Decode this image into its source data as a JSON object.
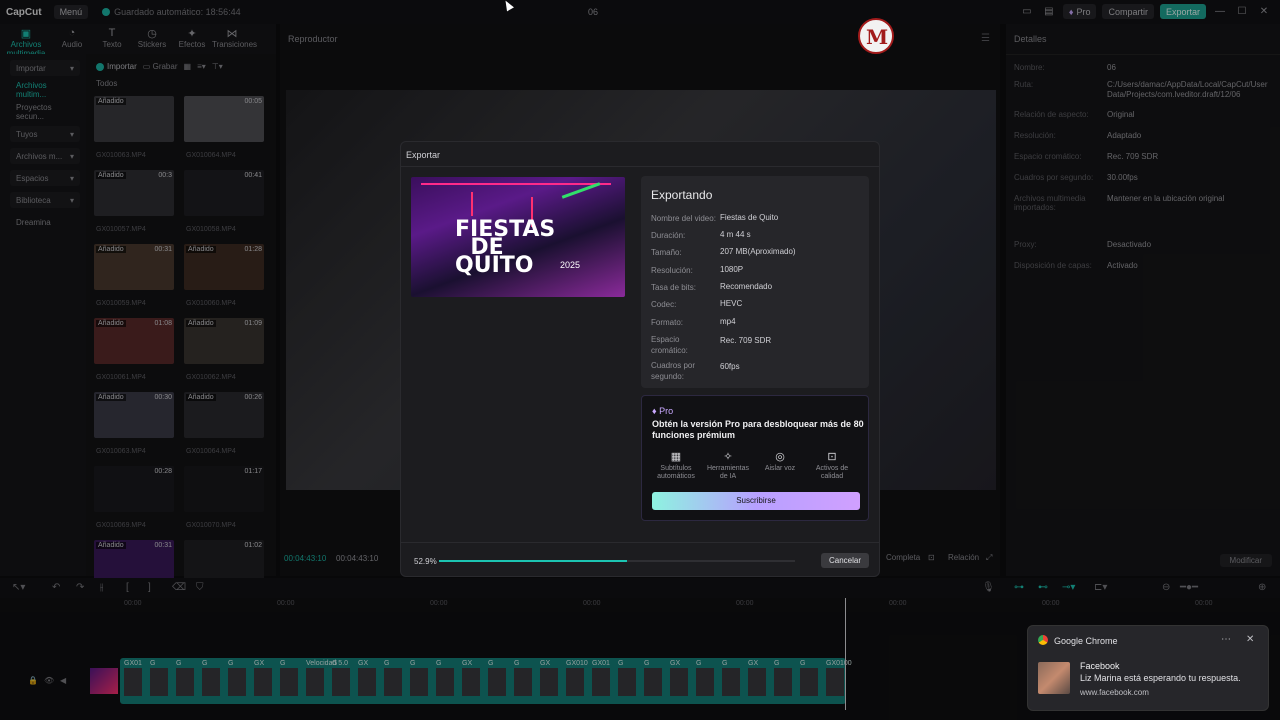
{
  "titlebar": {
    "logo": "CapCut",
    "menu": "Menú",
    "autosave": "Guardado automático: 18:56:44",
    "project": "06",
    "pro": "Pro",
    "share": "Compartir",
    "export": "Exportar"
  },
  "toptabs": [
    {
      "label": "Archivos multimedia",
      "icon": "▣"
    },
    {
      "label": "Audio",
      "icon": "◔"
    },
    {
      "label": "Texto",
      "icon": "T"
    },
    {
      "label": "Stickers",
      "icon": "◷"
    },
    {
      "label": "Efectos",
      "icon": "✦"
    },
    {
      "label": "Transiciones",
      "icon": "⋈"
    }
  ],
  "leftnav": [
    "Importar",
    "Archivos multim...",
    "Proyectos secun...",
    "Tuyos",
    "Archivos m...",
    "Espacios",
    "Biblioteca",
    "Dreamina"
  ],
  "media": {
    "import": "Importar",
    "record": "Grabar",
    "all": "Todos",
    "thumbs": [
      {
        "badge": "Añadido",
        "dur": "",
        "name": "GX010063.MP4"
      },
      {
        "badge": "",
        "dur": "00:05",
        "name": "GX010064.MP4"
      },
      {
        "badge": "Añadido",
        "dur": "00:3",
        "name": "GX010057.MP4"
      },
      {
        "badge": "",
        "dur": "00:41",
        "name": "GX010058.MP4"
      },
      {
        "badge": "Añadido",
        "dur": "00:31",
        "name": "GX010059.MP4"
      },
      {
        "badge": "Añadido",
        "dur": "01:28",
        "name": "GX010060.MP4"
      },
      {
        "badge": "Añadido",
        "dur": "01:08",
        "name": "GX010061.MP4"
      },
      {
        "badge": "Añadido",
        "dur": "01:09",
        "name": "GX010062.MP4"
      },
      {
        "badge": "Añadido",
        "dur": "00:30",
        "name": "GX010063.MP4"
      },
      {
        "badge": "Añadido",
        "dur": "00:26",
        "name": "GX010064.MP4"
      },
      {
        "badge": "",
        "dur": "00:28",
        "name": "GX010069.MP4"
      },
      {
        "badge": "",
        "dur": "01:17",
        "name": "GX010070.MP4"
      },
      {
        "badge": "Añadido",
        "dur": "00:31",
        "name": ""
      },
      {
        "badge": "",
        "dur": "01:02",
        "name": ""
      }
    ]
  },
  "player": {
    "title": "Reproductor",
    "time_current": "00:04:43:10",
    "time_total": "00:04:43:10",
    "completa": "Completa",
    "relacion": "Relación"
  },
  "details": {
    "title": "Detalles",
    "rows": [
      {
        "label": "Nombre:",
        "value": "06"
      },
      {
        "label": "Ruta:",
        "value": "C:/Users/damac/AppData/Local/CapCut/User Data/Projects/com.lveditor.draft/12/06"
      },
      {
        "label": "Relación de aspecto:",
        "value": "Original"
      },
      {
        "label": "Resolución:",
        "value": "Adaptado"
      },
      {
        "label": "Espacio cromático:",
        "value": "Rec. 709 SDR"
      },
      {
        "label": "Cuadros por segundo:",
        "value": "30.00fps"
      },
      {
        "label": "Archivos multimedia importados:",
        "value": "Mantener en la ubicación original"
      },
      {
        "label": "Proxy:",
        "value": "Desactivado"
      },
      {
        "label": "Disposición de capas:",
        "value": "Activado"
      }
    ],
    "modify": "Modificar"
  },
  "ruler": [
    "00:00",
    "00:00",
    "00:00",
    "00:00",
    "00:00",
    "00:00",
    "00:00",
    "00:00"
  ],
  "clip_labels": [
    "GX01",
    "G",
    "G",
    "G",
    "G",
    "GX",
    "G",
    "Velocidad 5.0",
    "G",
    "GX",
    "G",
    "G",
    "G",
    "GX",
    "G",
    "G",
    "GX",
    "GX010",
    "GX01",
    "G",
    "G",
    "GX",
    "G",
    "G",
    "GX",
    "G",
    "G",
    "GX0100"
  ],
  "export_dialog": {
    "title": "Exportar",
    "preview_title": "FIESTAS DE QUITO",
    "preview_year": "2025",
    "heading": "Exportando",
    "rows": [
      {
        "label": "Nombre del video:",
        "value": "Fiestas de Quito"
      },
      {
        "label": "Duración:",
        "value": "4 m 44 s"
      },
      {
        "label": "Tamaño:",
        "value": "207 MB(Aproximado)"
      },
      {
        "label": "Resolución:",
        "value": "1080P"
      },
      {
        "label": "Tasa de bits:",
        "value": "Recomendado"
      },
      {
        "label": "Codec:",
        "value": "HEVC"
      },
      {
        "label": "Formato:",
        "value": "mp4"
      },
      {
        "label": "Espacio cromático:",
        "value": "Rec. 709 SDR"
      },
      {
        "label": "Cuadros por segundo:",
        "value": "60fps"
      }
    ],
    "pro": {
      "tag": "Pro",
      "heading": "Obtén la versión Pro para desbloquear más de 80 funciones prémium",
      "features": [
        {
          "label": "Subtítulos automáticos",
          "icon": "▦"
        },
        {
          "label": "Herramientas de IA",
          "icon": "✧"
        },
        {
          "label": "Aislar voz",
          "icon": "◎"
        },
        {
          "label": "Activos de calidad",
          "icon": "⊡"
        }
      ],
      "subscribe": "Suscribirse"
    },
    "progress_label": "52.9%",
    "progress": 0.529,
    "cancel": "Cancelar"
  },
  "notification": {
    "app": "Google Chrome",
    "title": "Facebook",
    "body": "Liz Marina está esperando tu respuesta.",
    "url": "www.facebook.com"
  },
  "colors": {
    "accent": "#1cc4b2",
    "export_btn": "#1ea393",
    "pro_purple": "#c9a8ff"
  }
}
